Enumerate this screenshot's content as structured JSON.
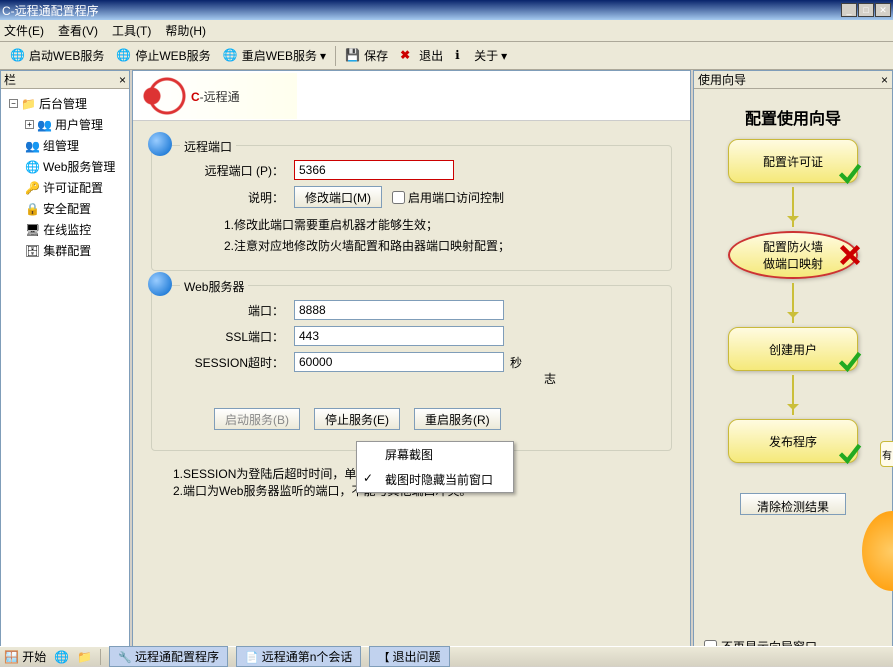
{
  "window": {
    "title": "C-远程通配置程序"
  },
  "menu": {
    "file": "文件(E)",
    "view": "查看(V)",
    "tools": "工具(T)",
    "help": "帮助(H)"
  },
  "toolbar": {
    "start_web": "启动WEB服务",
    "stop_web": "停止WEB服务",
    "restart_web": "重启WEB服务",
    "save": "保存",
    "exit": "退出",
    "about": "关于"
  },
  "leftpanel": {
    "header": "栏"
  },
  "tree": {
    "root": "后台管理",
    "items": [
      "用户管理",
      "组管理",
      "Web服务管理",
      "许可证配置",
      "安全配置",
      "在线监控",
      "集群配置"
    ]
  },
  "logo": {
    "prefix": "C",
    "rest": "-远程通"
  },
  "section1": {
    "legend": "远程端口",
    "port_label": "远程端口 (P)：",
    "port_value": "5366",
    "desc_label": "说明：",
    "modify_btn": "修改端口(M)",
    "enable_access": "启用端口访问控制",
    "note1": "1.修改此端口需要重启机器才能够生效；",
    "note2": "2.注意对应地修改防火墙配置和路由器端口映射配置；"
  },
  "section2": {
    "legend": "Web服务器",
    "port_label": "端口：",
    "port_value": "8888",
    "ssl_label": "SSL端口：",
    "ssl_value": "443",
    "session_label": "SESSION超时：",
    "session_value": "60000",
    "seconds": "秒",
    "log_suffix": "志",
    "start_btn": "启动服务(B)",
    "stop_btn": "停止服务(E)",
    "restart_btn": "重启服务(R)"
  },
  "notes": {
    "n1": "1.SESSION为登陆后超时时间，单位为秒。",
    "n2": "2.端口为Web服务器监听的端口，不能与其他端口冲突。"
  },
  "context_menu": {
    "item1": "屏幕截图",
    "item2": "截图时隐藏当前窗口"
  },
  "wizard": {
    "header": "使用向导",
    "title": "配置使用向导",
    "step1": "配置许可证",
    "step2a": "配置防火墙",
    "step2b": "做端口映射",
    "step3": "创建用户",
    "step4": "发布程序",
    "clear": "清除检测结果",
    "noshow": "不再显示向导窗口",
    "side": "有"
  },
  "taskbar": {
    "start": "开始",
    "t1": "远程通配置程序",
    "t2": "远程通第n个会话",
    "t3": "退出问题"
  }
}
